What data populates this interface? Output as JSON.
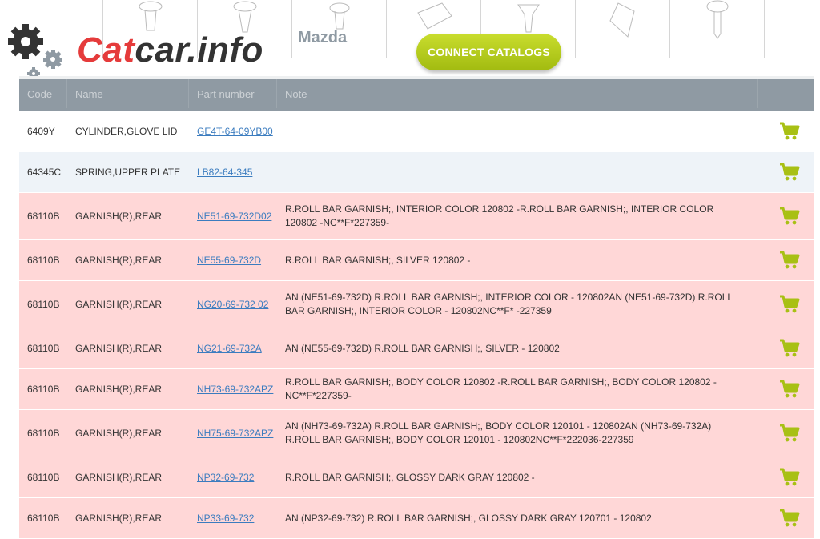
{
  "header": {
    "logo": {
      "part1": "Cat",
      "part2": "car.info"
    },
    "brand": "Mazda",
    "connect_label": "CONNECT CATALOGS",
    "colors": {
      "accent": "#a8c014",
      "logo_red": "#e53b3b"
    }
  },
  "table": {
    "columns": [
      "Code",
      "Name",
      "Part number",
      "Note"
    ],
    "rows": [
      {
        "code": "6409Y",
        "name": "CYLINDER,GLOVE LID",
        "part": "GE4T-64-09YB00",
        "note": "",
        "style": "white"
      },
      {
        "code": "64345C",
        "name": "SPRING,UPPER PLATE",
        "part": "LB82-64-345",
        "note": "",
        "style": "blue"
      },
      {
        "code": "68110B",
        "name": "GARNISH(R),REAR",
        "part": "NE51-69-732D02",
        "note": "R.ROLL BAR GARNISH;, INTERIOR COLOR 120802 -R.ROLL BAR GARNISH;, INTERIOR COLOR 120802 -NC**F*227359-",
        "style": "pink"
      },
      {
        "code": "68110B",
        "name": "GARNISH(R),REAR",
        "part": "NE55-69-732D",
        "note": "R.ROLL BAR GARNISH;, SILVER 120802 -",
        "style": "pink"
      },
      {
        "code": "68110B",
        "name": "GARNISH(R),REAR",
        "part": "NG20-69-732 02",
        "note": "AN (NE51-69-732D) R.ROLL BAR GARNISH;, INTERIOR COLOR - 120802AN (NE51-69-732D) R.ROLL BAR GARNISH;, INTERIOR COLOR - 120802NC**F* -227359",
        "style": "pink"
      },
      {
        "code": "68110B",
        "name": "GARNISH(R),REAR",
        "part": "NG21-69-732A",
        "note": "AN (NE55-69-732D) R.ROLL BAR GARNISH;, SILVER - 120802",
        "style": "pink"
      },
      {
        "code": "68110B",
        "name": "GARNISH(R),REAR",
        "part": "NH73-69-732APZ",
        "note": "R.ROLL BAR GARNISH;, BODY COLOR 120802 -R.ROLL BAR GARNISH;, BODY COLOR 120802 -NC**F*227359-",
        "style": "pink"
      },
      {
        "code": "68110B",
        "name": "GARNISH(R),REAR",
        "part": "NH75-69-732APZ",
        "note": "AN (NH73-69-732A) R.ROLL BAR GARNISH;, BODY COLOR 120101 - 120802AN (NH73-69-732A) R.ROLL BAR GARNISH;, BODY COLOR 120101 - 120802NC**F*222036-227359",
        "style": "pink"
      },
      {
        "code": "68110B",
        "name": "GARNISH(R),REAR",
        "part": "NP32-69-732",
        "note": "R.ROLL BAR GARNISH;, GLOSSY DARK GRAY 120802 -",
        "style": "pink"
      },
      {
        "code": "68110B",
        "name": "GARNISH(R),REAR",
        "part": "NP33-69-732",
        "note": "AN (NP32-69-732) R.ROLL BAR GARNISH;, GLOSSY DARK GRAY 120701 - 120802",
        "style": "pink"
      }
    ],
    "cart_icon": "shopping-cart-icon"
  }
}
